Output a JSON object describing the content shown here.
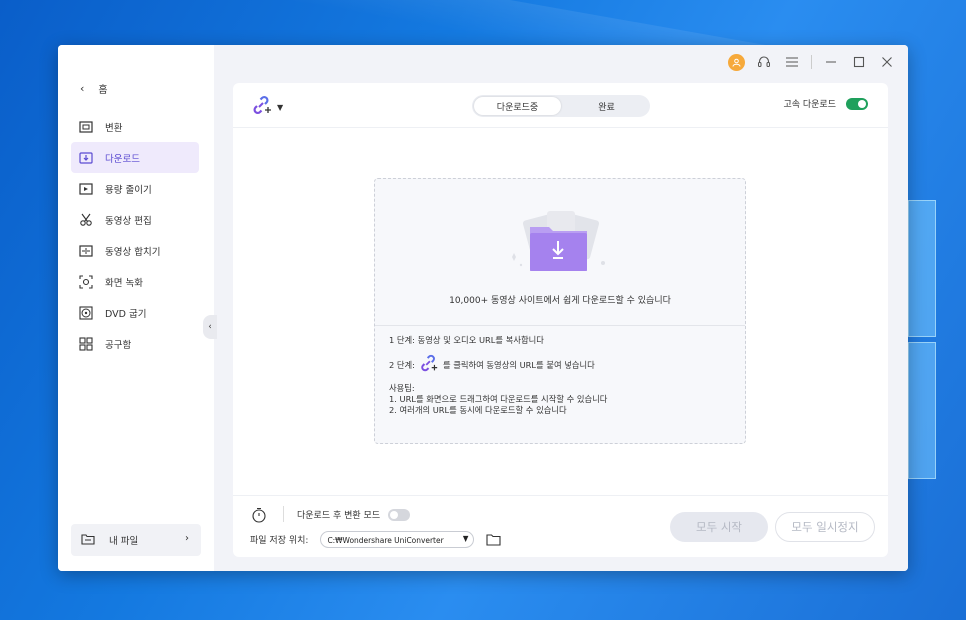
{
  "sidebar": {
    "home_label": "홈",
    "items": [
      {
        "label": "변환",
        "icon": "convert-icon"
      },
      {
        "label": "다운로드",
        "icon": "download-icon"
      },
      {
        "label": "용량 줄이기",
        "icon": "compress-icon"
      },
      {
        "label": "동영상 편집",
        "icon": "scissors-icon"
      },
      {
        "label": "동영상 합치기",
        "icon": "merge-icon"
      },
      {
        "label": "화면 녹화",
        "icon": "screen-record-icon"
      },
      {
        "label": "DVD 굽기",
        "icon": "dvd-icon"
      },
      {
        "label": "공구함",
        "icon": "toolbox-icon"
      }
    ],
    "active_index": 1,
    "my_files_label": "내 파일"
  },
  "titlebar": {
    "icons": [
      "user-avatar-icon",
      "headset-icon",
      "menu-icon",
      "minimize-icon",
      "maximize-icon",
      "close-icon"
    ]
  },
  "header": {
    "tabs": [
      "다운로드중",
      "완료"
    ],
    "active_tab": 0,
    "fast_download_label": "고속 다운로드",
    "fast_download_on": true
  },
  "dropzone": {
    "caption": "10,000+ 동영상 사이트에서 쉽게 다운로드할 수 있습니다",
    "step1": "1 단계: 동영상 및 오디오 URL를 복사합니다",
    "step2_prefix": "2 단계:",
    "step2_suffix": "를 클릭하여 동영상의 URL를 붙여 넣습니다",
    "tips_title": "사용팁:",
    "tip1": "1. URL를 화면으로 드래그하여 다운로드를 시작할 수 있습니다",
    "tip2": "2. 여러개의 URL를 동시에 다운로드할 수 있습니다"
  },
  "footer": {
    "convert_after_label": "다운로드 후 변환 모드",
    "convert_after_on": false,
    "save_location_label": "파일 저장 위치:",
    "save_path": "C:₩Wondershare UniConverter",
    "start_all_label": "모두 시작",
    "pause_all_label": "모두 일시정지"
  },
  "colors": {
    "accent": "#6c4ee0",
    "toggle_on": "#1fa05c",
    "active_nav_bg": "#efeafc"
  }
}
